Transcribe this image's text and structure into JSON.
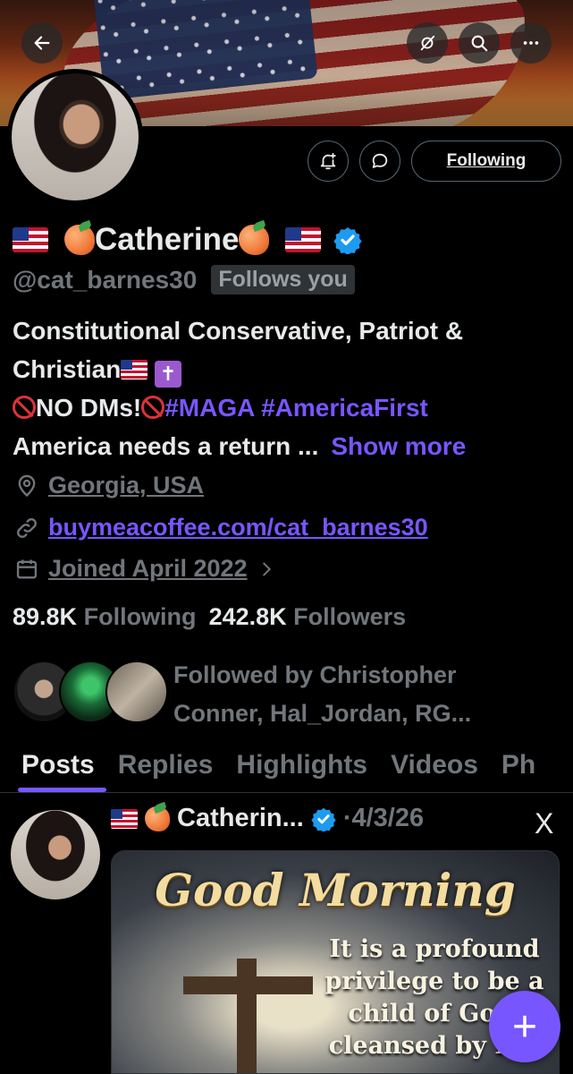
{
  "header": {
    "back_icon": "arrow-left-icon",
    "hide_icon": "eye-slash-icon",
    "search_icon": "search-icon",
    "more_icon": "more-horizontal-icon"
  },
  "profile": {
    "name": "Catherine",
    "handle": "@cat_barnes30",
    "follows_you": "Follows you",
    "verified": true,
    "bio_line1": "Constitutional Conservative, Patriot &",
    "bio_line2": "Christian",
    "bio_no_dms": "NO DMs!",
    "hashtag1": "#MAGA",
    "hashtag2": "#AmericaFirst",
    "bio_line4": "America needs a return ...",
    "show_more": "Show more",
    "location": "Georgia, USA",
    "website": "buymeacoffee.com/cat_barnes30",
    "joined": "Joined April 2022",
    "following_count": "89.8K",
    "following_label": "Following",
    "followers_count": "242.8K",
    "followers_label": "Followers",
    "followed_by": "Followed by Christopher Conner, Hal_Jordan, RG..."
  },
  "actions": {
    "notify_icon": "bell-plus-icon",
    "message_icon": "message-icon",
    "following_label": "Following"
  },
  "tabs": [
    {
      "label": "Posts"
    },
    {
      "label": "Replies"
    },
    {
      "label": "Highlights"
    },
    {
      "label": "Videos"
    },
    {
      "label": "Ph"
    }
  ],
  "post": {
    "name": "Catherin...",
    "date": "·4/3/26",
    "platform_logo": "X",
    "media_title": "Good Morning",
    "media_text": "It is a profound privilege to be a child of God, cleansed by His"
  },
  "fab": {
    "label": "+"
  },
  "colors": {
    "accent": "#7856ff",
    "verified": "#1d9bf0",
    "muted": "#71767b",
    "background": "#000000"
  }
}
